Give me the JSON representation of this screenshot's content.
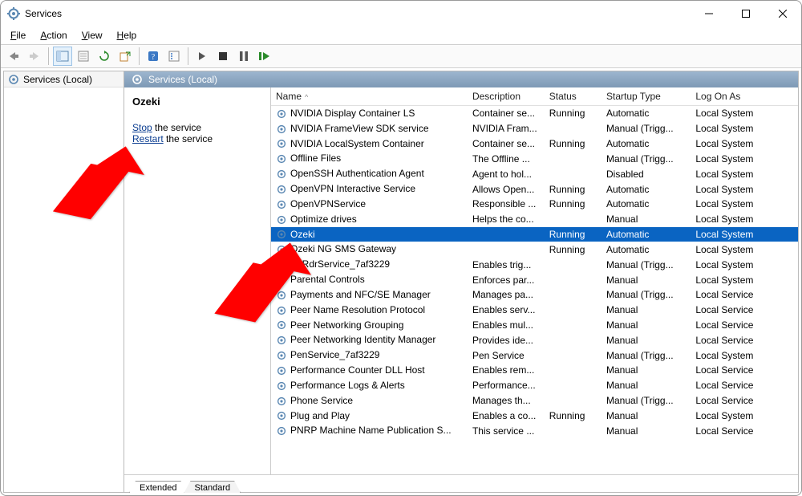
{
  "window": {
    "title": "Services"
  },
  "menu": {
    "file": "File",
    "action": "Action",
    "view": "View",
    "help": "Help"
  },
  "left": {
    "heading": "Services (Local)"
  },
  "right": {
    "heading": "Services (Local)"
  },
  "detail": {
    "selected_name": "Ozeki",
    "stop_label": "Stop",
    "stop_suffix": " the service",
    "restart_label": "Restart",
    "restart_suffix": " the service"
  },
  "columns": {
    "name": "Name",
    "desc": "Description",
    "status": "Status",
    "start": "Startup Type",
    "logon": "Log On As"
  },
  "tabs": {
    "extended": "Extended",
    "standard": "Standard"
  },
  "services": [
    {
      "name": "NVIDIA Display Container LS",
      "desc": "Container se...",
      "status": "Running",
      "start": "Automatic",
      "logon": "Local System"
    },
    {
      "name": "NVIDIA FrameView SDK service",
      "desc": "NVIDIA Fram...",
      "status": "",
      "start": "Manual (Trigg...",
      "logon": "Local System"
    },
    {
      "name": "NVIDIA LocalSystem Container",
      "desc": "Container se...",
      "status": "Running",
      "start": "Automatic",
      "logon": "Local System"
    },
    {
      "name": "Offline Files",
      "desc": "The Offline ...",
      "status": "",
      "start": "Manual (Trigg...",
      "logon": "Local System"
    },
    {
      "name": "OpenSSH Authentication Agent",
      "desc": "Agent to hol...",
      "status": "",
      "start": "Disabled",
      "logon": "Local System"
    },
    {
      "name": "OpenVPN Interactive Service",
      "desc": "Allows Open...",
      "status": "Running",
      "start": "Automatic",
      "logon": "Local System"
    },
    {
      "name": "OpenVPNService",
      "desc": "Responsible ...",
      "status": "Running",
      "start": "Automatic",
      "logon": "Local System"
    },
    {
      "name": "Optimize drives",
      "desc": "Helps the co...",
      "status": "",
      "start": "Manual",
      "logon": "Local System"
    },
    {
      "name": "Ozeki",
      "desc": "",
      "status": "Running",
      "start": "Automatic",
      "logon": "Local System",
      "selected": true
    },
    {
      "name": "Ozeki NG SMS Gateway",
      "desc": "",
      "status": "Running",
      "start": "Automatic",
      "logon": "Local System"
    },
    {
      "name": "P9RdrService_7af3229",
      "desc": "Enables trig...",
      "status": "",
      "start": "Manual (Trigg...",
      "logon": "Local System"
    },
    {
      "name": "Parental Controls",
      "desc": "Enforces par...",
      "status": "",
      "start": "Manual",
      "logon": "Local System"
    },
    {
      "name": "Payments and NFC/SE Manager",
      "desc": "Manages pa...",
      "status": "",
      "start": "Manual (Trigg...",
      "logon": "Local Service"
    },
    {
      "name": "Peer Name Resolution Protocol",
      "desc": "Enables serv...",
      "status": "",
      "start": "Manual",
      "logon": "Local Service"
    },
    {
      "name": "Peer Networking Grouping",
      "desc": "Enables mul...",
      "status": "",
      "start": "Manual",
      "logon": "Local Service"
    },
    {
      "name": "Peer Networking Identity Manager",
      "desc": "Provides ide...",
      "status": "",
      "start": "Manual",
      "logon": "Local Service"
    },
    {
      "name": "PenService_7af3229",
      "desc": "Pen Service",
      "status": "",
      "start": "Manual (Trigg...",
      "logon": "Local System"
    },
    {
      "name": "Performance Counter DLL Host",
      "desc": "Enables rem...",
      "status": "",
      "start": "Manual",
      "logon": "Local Service"
    },
    {
      "name": "Performance Logs & Alerts",
      "desc": "Performance...",
      "status": "",
      "start": "Manual",
      "logon": "Local Service"
    },
    {
      "name": "Phone Service",
      "desc": "Manages th...",
      "status": "",
      "start": "Manual (Trigg...",
      "logon": "Local Service"
    },
    {
      "name": "Plug and Play",
      "desc": "Enables a co...",
      "status": "Running",
      "start": "Manual",
      "logon": "Local System"
    },
    {
      "name": "PNRP Machine Name Publication S...",
      "desc": "This service ...",
      "status": "",
      "start": "Manual",
      "logon": "Local Service"
    }
  ]
}
